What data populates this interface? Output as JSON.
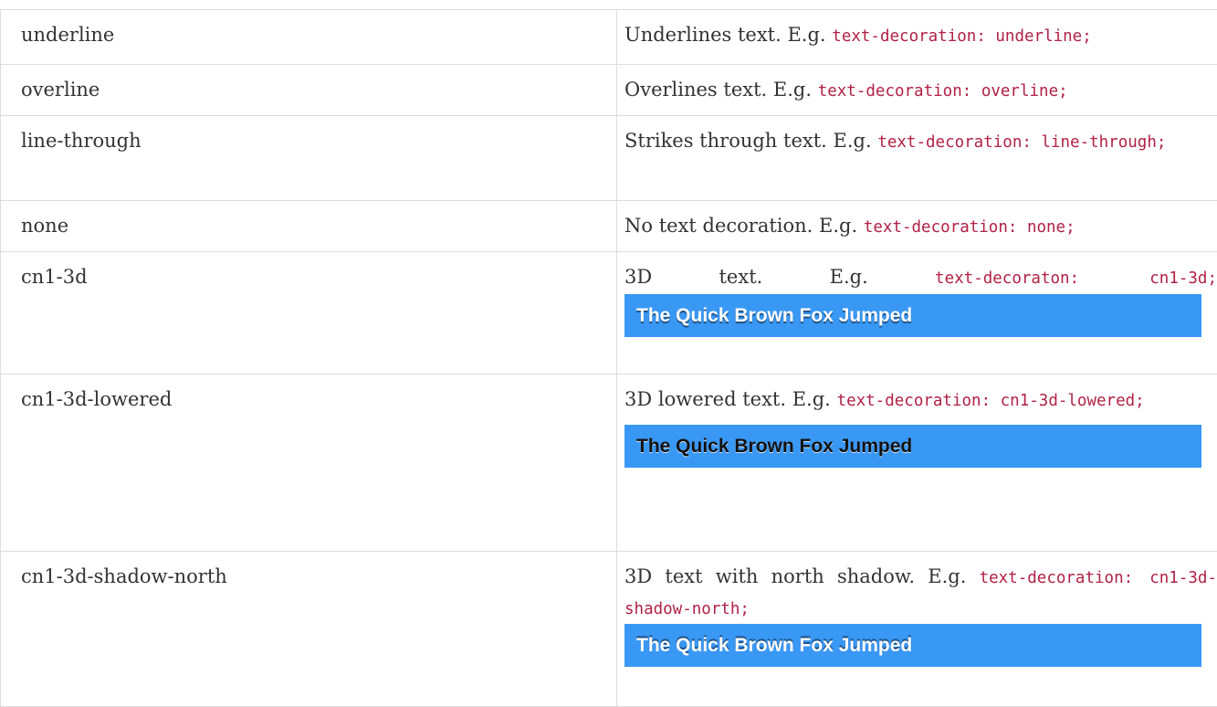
{
  "rows": [
    {
      "value": "underline",
      "desc": "Underlines text. E.g.",
      "code": "text-decoration: underline;"
    },
    {
      "value": "overline",
      "desc": "Overlines text. E.g.",
      "code": "text-decoration: overline;"
    },
    {
      "value": "line-through",
      "desc": "Strikes through text. E.g.",
      "code": "text-decoration: line-through;"
    },
    {
      "value": "none",
      "desc": "No text decoration. E.g.",
      "code": "text-decoration: none;"
    },
    {
      "value": "cn1-3d",
      "desc": "3D text. E.g.",
      "code": "text-decoraton: cn1-3d;",
      "demo": "The Quick Brown Fox Jumped"
    },
    {
      "value": "cn1-3d-lowered",
      "desc": "3D lowered text. E.g.",
      "code": "text-decoration: cn1-3d-lowered;",
      "demo": "The Quick Brown Fox Jumped"
    },
    {
      "value": "cn1-3d-shadow-north",
      "desc": "3D text with north shadow. E.g.",
      "code": "text-decoration: cn1-3d-shadow-north;",
      "demo": "The Quick Brown Fox Jumped"
    }
  ],
  "colors": {
    "code_text": "#b12146",
    "demo_background": "#3a98f5",
    "border": "#dddddd",
    "body_text": "#333333"
  }
}
